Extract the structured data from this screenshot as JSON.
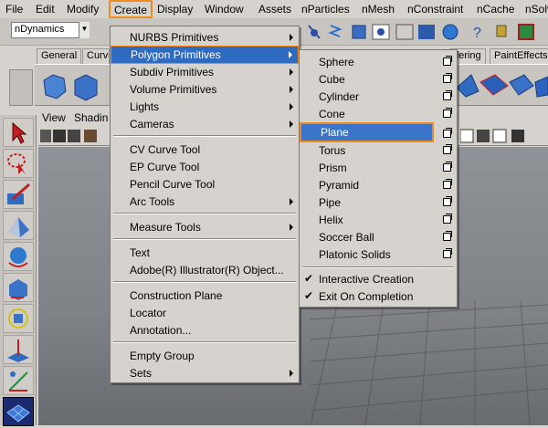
{
  "menubar": {
    "items": [
      "File",
      "Edit",
      "Modify",
      "Create",
      "Display",
      "Window",
      "Assets",
      "nParticles",
      "nMesh",
      "nConstraint",
      "nCache",
      "nSolv"
    ]
  },
  "statusline": {
    "mode": "nDynamics"
  },
  "shelf": {
    "tabs": [
      "General",
      "Curve",
      "dering",
      "PaintEffects"
    ]
  },
  "panel": {
    "menus": [
      "View",
      "Shadin"
    ]
  },
  "create_menu": {
    "items": [
      "NURBS Primitives",
      "Polygon Primitives",
      "Subdiv Primitives",
      "Volume Primitives",
      "Lights",
      "Cameras",
      "CV Curve Tool",
      "EP Curve Tool",
      "Pencil Curve Tool",
      "Arc Tools",
      "Measure Tools",
      "Text",
      "Adobe(R) Illustrator(R) Object...",
      "Construction Plane",
      "Locator",
      "Annotation...",
      "Empty Group",
      "Sets"
    ],
    "highlighted": "Polygon Primitives"
  },
  "poly_menu": {
    "items": [
      "Sphere",
      "Cube",
      "Cylinder",
      "Cone",
      "Plane",
      "Torus",
      "Prism",
      "Pyramid",
      "Pipe",
      "Helix",
      "Soccer Ball",
      "Platonic Solids"
    ],
    "highlighted": "Plane",
    "toggles": [
      "Interactive Creation",
      "Exit On Completion"
    ],
    "check_mark": "✔"
  },
  "colors": {
    "highlight": "#2f6bc1",
    "accent_outline": "#f08a1c"
  }
}
